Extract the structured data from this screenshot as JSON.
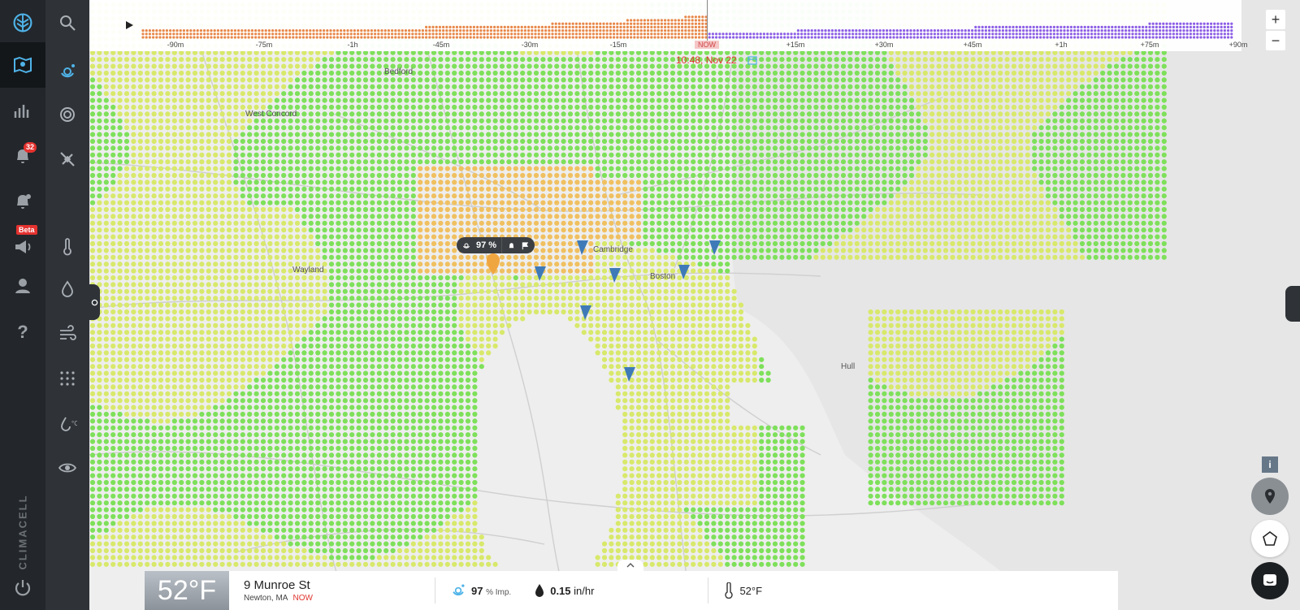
{
  "app": {
    "brand": "CLIMACELL"
  },
  "nav": {
    "main": [
      {
        "icon": "logo-icon"
      },
      {
        "icon": "map-icon",
        "active": true
      },
      {
        "icon": "chart-icon"
      },
      {
        "icon": "alerts-icon",
        "badge": "32"
      },
      {
        "icon": "alert-settings-icon"
      },
      {
        "icon": "announcements-icon",
        "badge": "Beta"
      },
      {
        "icon": "user-icon"
      },
      {
        "icon": "help-icon"
      },
      {
        "icon": "power-icon"
      }
    ],
    "layers": [
      "search-icon",
      "precipitation-icon",
      "radar-icon",
      "satellite-icon",
      "temperature-icon",
      "humidity-icon",
      "wind-icon",
      "grid-icon",
      "dewpoint-icon",
      "visibility-icon"
    ]
  },
  "timeline": {
    "play_label": "▶",
    "ticks": [
      "-90m",
      "-75m",
      "-1h",
      "-45m",
      "-30m",
      "-15m",
      "NOW",
      "+15m",
      "+30m",
      "+45m",
      "+1h",
      "+75m",
      "+90m"
    ],
    "now_label": "NOW",
    "now_datetime": "10:48, Nov 22",
    "past_color": "#e8874a",
    "future_color": "#8c5ee6"
  },
  "zoom": {
    "in": "+",
    "out": "−"
  },
  "popup": {
    "value": "97 %"
  },
  "map": {
    "labels": [
      "Bedford",
      "West Concord",
      "Wayland",
      "Cambridge",
      "Boston",
      "Hull"
    ],
    "dot_colors": {
      "low": "#7ee05a",
      "mid": "#d8e86a",
      "high": "#f0c060"
    }
  },
  "bottom": {
    "temperature": "52°F",
    "street": "9 Munroe St",
    "city": "Newton, MA",
    "time_tag": "NOW",
    "impact_value": "97",
    "impact_unit": "% Imp.",
    "precip_value": "0.15",
    "precip_unit": "in/hr",
    "temp_small": "52°F"
  },
  "controls": {
    "info": "i"
  }
}
